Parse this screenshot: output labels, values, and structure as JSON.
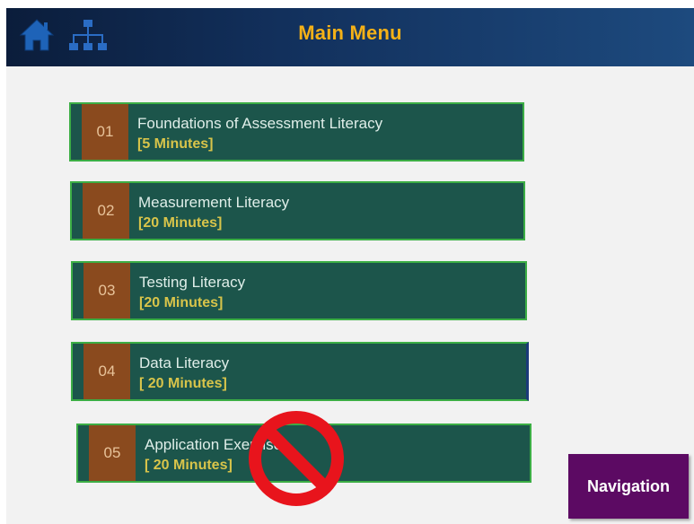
{
  "header": {
    "title": "Main Menu",
    "home_icon": "home-icon",
    "sitemap_icon": "sitemap-icon"
  },
  "menu_items": [
    {
      "number": "01",
      "title": "Foundations of Assessment Literacy",
      "duration": "[5 Minutes]"
    },
    {
      "number": "02",
      "title": "Measurement Literacy",
      "duration": "[20 Minutes]"
    },
    {
      "number": "03",
      "title": "Testing Literacy",
      "duration": "[20 Minutes]"
    },
    {
      "number": "04",
      "title": "Data Literacy",
      "duration": "[ 20 Minutes]"
    },
    {
      "number": "05",
      "title": "Application Exercises",
      "duration": "[ 20 Minutes]",
      "locked": true
    }
  ],
  "navigation_button": {
    "label": "Navigation"
  },
  "colors": {
    "header_title": "#f5b117",
    "item_background": "#1c554b",
    "item_border": "#3cae45",
    "number_block": "#8a4a1e",
    "duration_text": "#d8c44a",
    "nav_button": "#5c0a63",
    "no_symbol": "#e8141c"
  }
}
